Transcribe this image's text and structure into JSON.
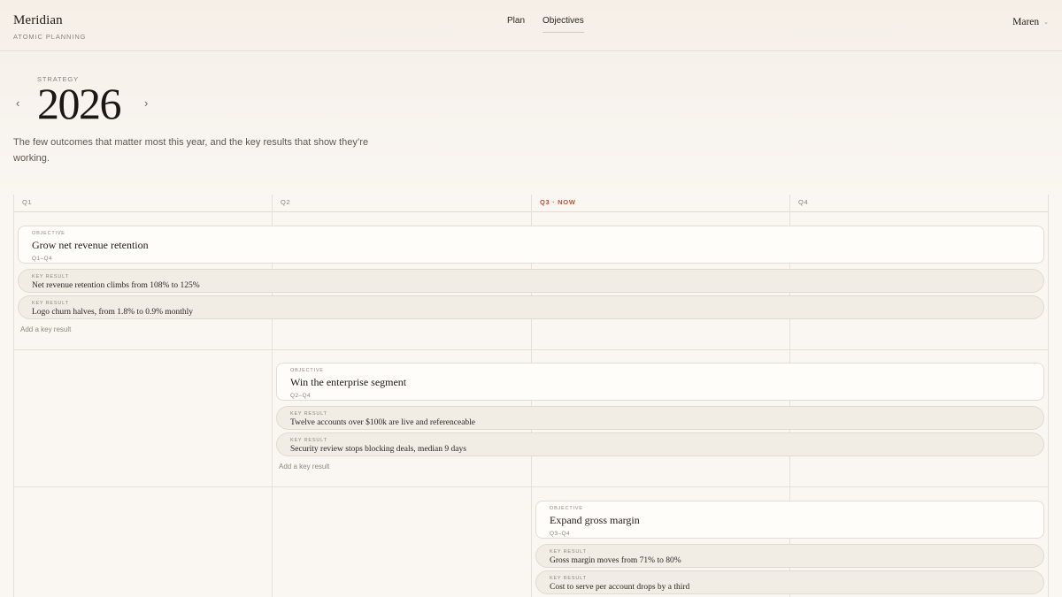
{
  "brand": {
    "name": "Meridian",
    "subtitle": "ATOMIC PLANNING"
  },
  "nav": [
    {
      "label": "Plan",
      "active": false
    },
    {
      "label": "Objectives",
      "active": true
    }
  ],
  "user": {
    "name": "Maren"
  },
  "hero": {
    "eyebrow": "STRATEGY",
    "year": "2026",
    "description": "The few outcomes that matter most this year, and the key results that show they’re working."
  },
  "quarters": [
    {
      "label": "Q1",
      "current": false
    },
    {
      "label": "Q2",
      "current": false
    },
    {
      "label": "Q3 · NOW",
      "current": true
    },
    {
      "label": "Q4",
      "current": false
    }
  ],
  "colors": {
    "accent": "#b8553a",
    "background": "#faf7f2",
    "card": "#fffdf9",
    "key_result": "#f1ece4"
  },
  "objectives": [
    {
      "tag": "OBJECTIVE",
      "title": "Grow net revenue retention",
      "range": "Q1–Q4",
      "key_results": [
        {
          "tag": "KEY RESULT",
          "title": "Net revenue retention climbs from 108% to 125%"
        },
        {
          "tag": "KEY RESULT",
          "title": "Logo churn halves, from 1.8% to 0.9% monthly"
        }
      ],
      "add_label": "Add a key result"
    },
    {
      "tag": "OBJECTIVE",
      "title": "Win the enterprise segment",
      "range": "Q2–Q4",
      "key_results": [
        {
          "tag": "KEY RESULT",
          "title": "Twelve accounts over $100k are live and referenceable"
        },
        {
          "tag": "KEY RESULT",
          "title": "Security review stops blocking deals, median 9 days"
        }
      ],
      "add_label": "Add a key result"
    },
    {
      "tag": "OBJECTIVE",
      "title": "Expand gross margin",
      "range": "Q3–Q4",
      "key_results": [
        {
          "tag": "KEY RESULT",
          "title": "Gross margin moves from 71% to 80%"
        },
        {
          "tag": "KEY RESULT",
          "title": "Cost to serve per account drops by a third"
        }
      ]
    }
  ]
}
